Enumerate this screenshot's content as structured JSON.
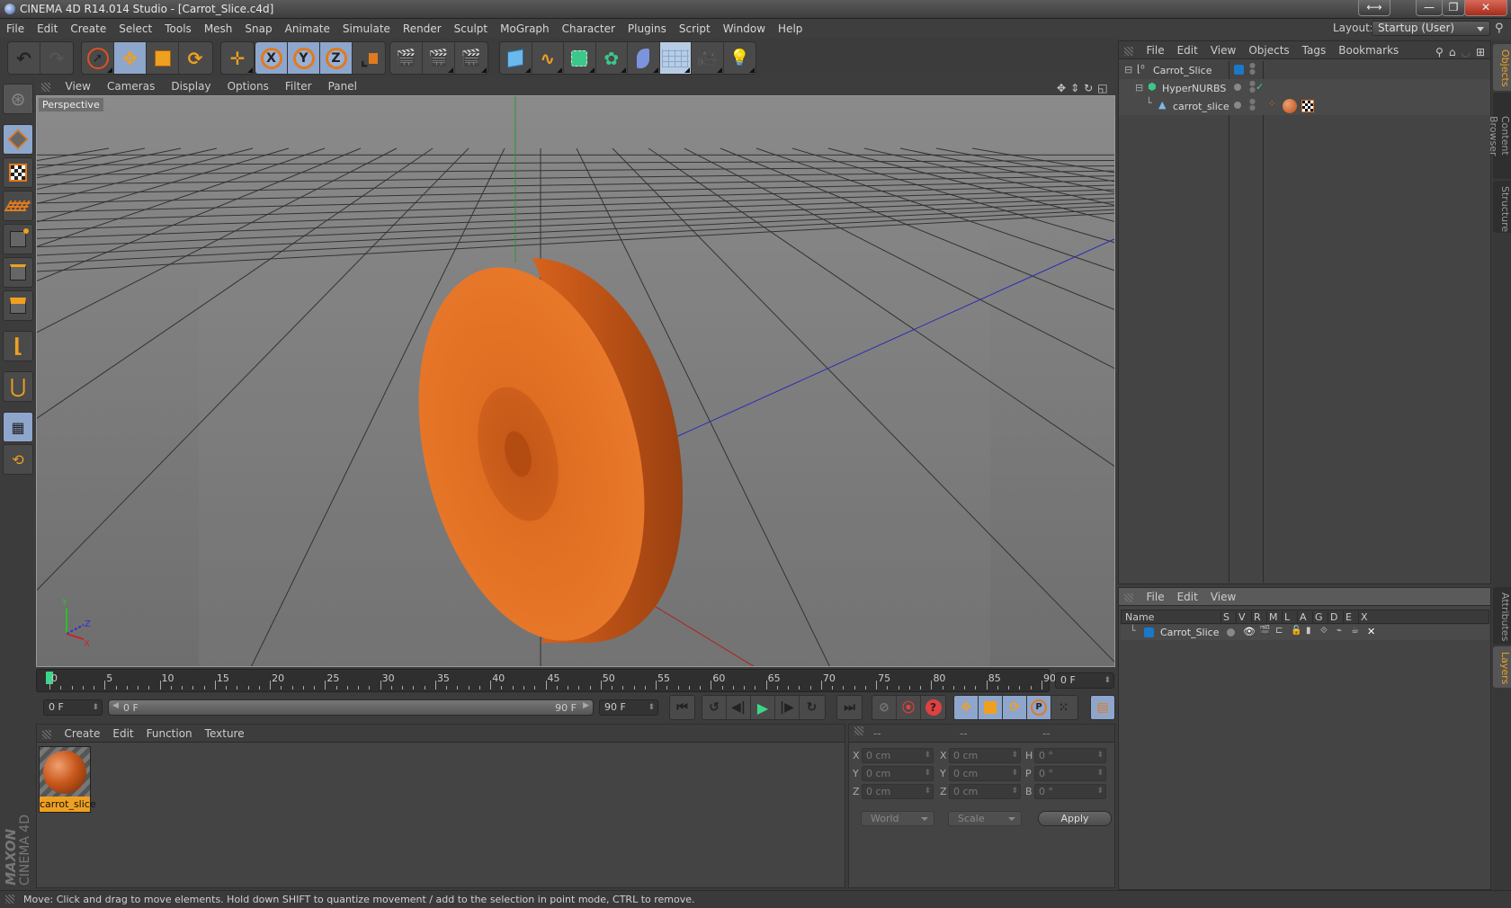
{
  "window": {
    "title": "CINEMA 4D R14.014 Studio - [Carrot_Slice.c4d]",
    "controls": [
      "resize-icon",
      "minimize-icon",
      "restore-icon",
      "close-icon"
    ]
  },
  "menubar": {
    "items": [
      "File",
      "Edit",
      "Create",
      "Select",
      "Tools",
      "Mesh",
      "Snap",
      "Animate",
      "Simulate",
      "Render",
      "Sculpt",
      "MoGraph",
      "Character",
      "Plugins",
      "Script",
      "Window",
      "Help"
    ],
    "layout_label": "Layout:",
    "layout_value": "Startup (User)"
  },
  "toolbar": {
    "groups": [
      [
        "undo-icon",
        "redo-icon"
      ],
      [
        "live-selection-icon",
        "move-icon",
        "scale-icon",
        "rotate-icon"
      ],
      [
        "recent-tool-move-icon"
      ],
      [
        "x-axis-lock-icon",
        "y-axis-lock-icon",
        "z-axis-lock-icon",
        "coordinate-system-icon"
      ],
      [
        "render-view-icon",
        "render-picture-viewer-icon",
        "render-settings-icon"
      ],
      [
        "cube-primitive-icon",
        "spline-pen-icon",
        "nurbs-icon",
        "mograph-cloner-icon",
        "deformer-bend-icon",
        "floor-environment-icon",
        "camera-icon",
        "light-icon"
      ]
    ],
    "axis_labels": [
      "X",
      "Y",
      "Z"
    ]
  },
  "left_tools": [
    "make-editable-icon",
    "model-mode-icon",
    "texture-mode-icon",
    "workplane-mode-icon",
    "points-mode-icon",
    "edges-mode-icon",
    "polygons-mode-icon",
    "axis-mode-icon",
    "snap-magnet-icon",
    "workplane-lock-icon",
    "workplane-rotate-icon"
  ],
  "viewport": {
    "menu": [
      "View",
      "Cameras",
      "Display",
      "Options",
      "Filter",
      "Panel"
    ],
    "label": "Perspective",
    "nav_icons": [
      "pan-icon",
      "dolly-icon",
      "orbit-icon",
      "maximize-view-icon"
    ],
    "axis_gizmo": {
      "y": "Y",
      "z": "Z",
      "x": "X"
    },
    "object": "carrot_slice"
  },
  "timeline": {
    "ticks": [
      "0",
      "5",
      "10",
      "15",
      "20",
      "25",
      "30",
      "35",
      "40",
      "45",
      "50",
      "55",
      "60",
      "65",
      "70",
      "75",
      "80",
      "85",
      "90"
    ],
    "current_frame_field": "0 F",
    "start_field": "0 F",
    "range_start": "0 F",
    "range_end": "90 F",
    "end_field": "90 F",
    "playhead_frame": 0,
    "transport": [
      "go-to-start-icon",
      "prev-key-icon",
      "prev-frame-icon",
      "play-icon",
      "next-frame-icon",
      "next-key-icon",
      "go-to-end-icon"
    ],
    "record": [
      "autokey-off-icon",
      "record-keys-icon",
      "keyframe-selection-icon"
    ],
    "key_channels": [
      "key-position-icon",
      "key-scale-icon",
      "key-rotation-icon",
      "key-parameter-icon",
      "key-point-level-icon"
    ],
    "timeline-button": "timeline-icon"
  },
  "material_manager": {
    "menu": [
      "Create",
      "Edit",
      "Function",
      "Texture"
    ],
    "materials": [
      {
        "name": "carrot_slice",
        "selected": true
      }
    ]
  },
  "coordinates": {
    "headers": [
      "--",
      "--",
      "--"
    ],
    "rows": [
      {
        "a1": "X",
        "v1": "0 cm",
        "a2": "X",
        "v2": "0 cm",
        "a3": "H",
        "v3": "0 °"
      },
      {
        "a1": "Y",
        "v1": "0 cm",
        "a2": "Y",
        "v2": "0 cm",
        "a3": "P",
        "v3": "0 °"
      },
      {
        "a1": "Z",
        "v1": "0 cm",
        "a2": "Z",
        "v2": "0 cm",
        "a3": "B",
        "v3": "0 °"
      }
    ],
    "space": "World",
    "mode": "Scale",
    "apply": "Apply"
  },
  "object_manager": {
    "menu": [
      "File",
      "Edit",
      "View",
      "Objects",
      "Tags",
      "Bookmarks"
    ],
    "objects": [
      {
        "name": "Carrot_Slice",
        "icon": "null-object-icon",
        "depth": 0
      },
      {
        "name": "HyperNURBS",
        "icon": "hypernurbs-icon",
        "depth": 1
      },
      {
        "name": "carrot_slice",
        "icon": "polygon-object-icon",
        "depth": 2
      }
    ]
  },
  "layer_manager": {
    "menu": [
      "File",
      "Edit",
      "View"
    ],
    "columns": [
      "Name",
      "S",
      "V",
      "R",
      "M",
      "L",
      "A",
      "G",
      "D",
      "E",
      "X"
    ],
    "layers": [
      {
        "name": "Carrot_Slice",
        "color": "#1a78c8"
      }
    ]
  },
  "side_tabs": {
    "top": [
      "Objects",
      "Content Browser",
      "Structure"
    ],
    "bottom": [
      "Attributes",
      "Layers"
    ],
    "active_top": "Objects",
    "active_bottom": "Layers"
  },
  "branding": {
    "maxon": "MAXON",
    "product": "CINEMA 4D"
  },
  "status": "Move: Click and drag to move elements. Hold down SHIFT to quantize movement / add to the selection in point mode, CTRL to remove.",
  "colors": {
    "accent": "#f0a020",
    "selected_tool": "#8ea6cc",
    "playhead": "#3cd68a",
    "layer_blue": "#1a78c8"
  }
}
